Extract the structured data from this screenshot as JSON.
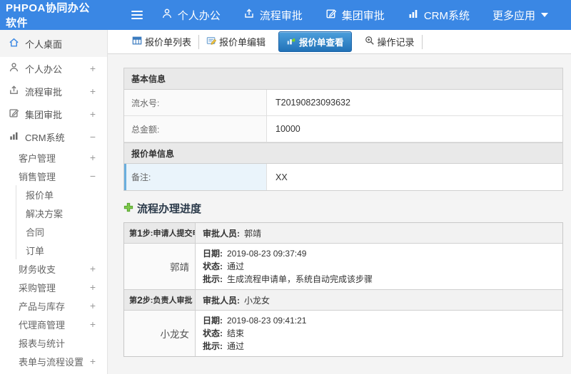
{
  "header": {
    "logo": "PHPOA协同办公软件",
    "nav": [
      {
        "label": "个人办公"
      },
      {
        "label": "流程审批"
      },
      {
        "label": "集团审批"
      },
      {
        "label": "CRM系统"
      },
      {
        "label": "更多应用"
      }
    ]
  },
  "sidebar": {
    "items": [
      {
        "label": "个人桌面",
        "expander": ""
      },
      {
        "label": "个人办公",
        "expander": "+"
      },
      {
        "label": "流程审批",
        "expander": "+"
      },
      {
        "label": "集团审批",
        "expander": "+"
      },
      {
        "label": "CRM系统",
        "expander": "−"
      },
      {
        "label": "客户管理",
        "expander": "+"
      },
      {
        "label": "销售管理",
        "expander": "−"
      },
      {
        "label": "报价单",
        "expander": ""
      },
      {
        "label": "解决方案",
        "expander": ""
      },
      {
        "label": "合同",
        "expander": ""
      },
      {
        "label": "订单",
        "expander": ""
      },
      {
        "label": "财务收支",
        "expander": "+"
      },
      {
        "label": "采购管理",
        "expander": "+"
      },
      {
        "label": "产品与库存",
        "expander": "+"
      },
      {
        "label": "代理商管理",
        "expander": "+"
      },
      {
        "label": "报表与统计",
        "expander": ""
      },
      {
        "label": "表单与流程设置",
        "expander": "+"
      }
    ]
  },
  "tabs": [
    {
      "label": "报价单列表"
    },
    {
      "label": "报价单编辑"
    },
    {
      "label": "报价单查看"
    },
    {
      "label": "操作记录"
    }
  ],
  "form": {
    "sections": [
      {
        "title": "基本信息",
        "rows": [
          {
            "label": "流水号:",
            "value": "T20190823093632"
          },
          {
            "label": "总金额:",
            "value": "10000"
          }
        ]
      },
      {
        "title": "报价单信息",
        "rows": [
          {
            "label": "备注:",
            "value": "XX"
          }
        ]
      }
    ]
  },
  "workflow": {
    "title": "流程办理进度",
    "labels": {
      "approver": "审批人员:",
      "date": "日期:",
      "status": "状态:",
      "comment": "批示:"
    },
    "steps": [
      {
        "step_pre": "第",
        "step_num": "1",
        "step_rest": "步:申请人提交申请",
        "approver": "郭靖",
        "name": "郭靖",
        "date": "2019-08-23 09:37:49",
        "status": "通过",
        "comment": "生成流程申请单，系统自动完成该步骤"
      },
      {
        "step_pre": "第",
        "step_num": "2",
        "step_rest": "步:负责人审批",
        "approver": "小龙女",
        "name": "小龙女",
        "date": "2019-08-23 09:41:21",
        "status": "结束",
        "comment": "通过"
      }
    ]
  },
  "colors": {
    "topbar": "#3a87e4",
    "active_tab": "#2c7cc4",
    "accent_green": "#5cb85c"
  }
}
